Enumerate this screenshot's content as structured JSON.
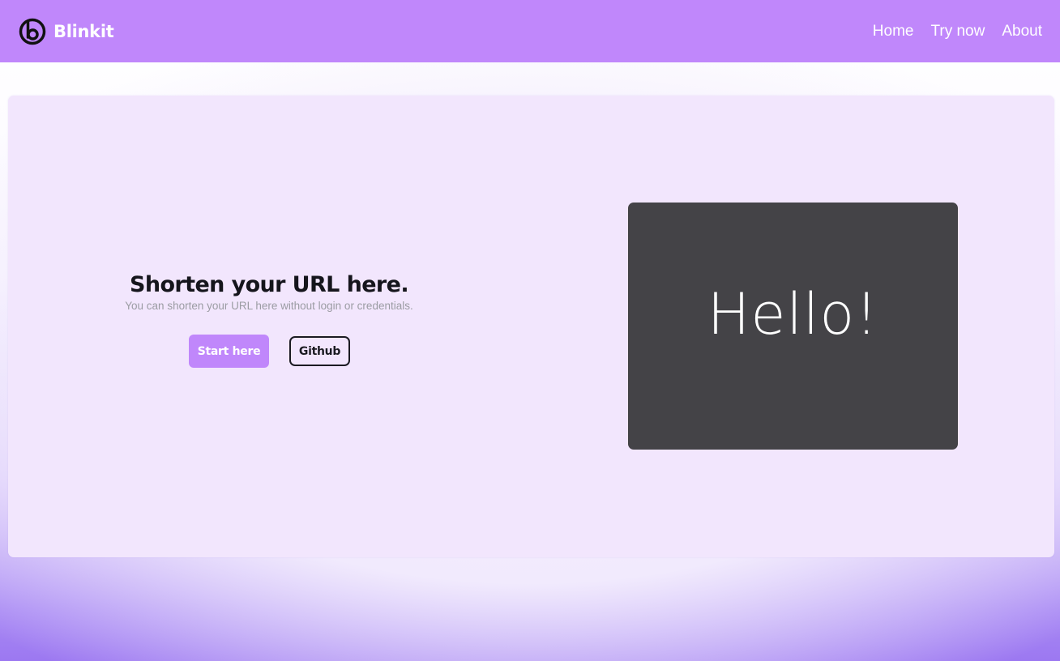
{
  "navbar": {
    "brand": {
      "name": "Blinkit",
      "icon": "blinkit-logo-icon"
    },
    "links": [
      {
        "label": "Home"
      },
      {
        "label": "Try now"
      },
      {
        "label": "About"
      }
    ]
  },
  "hero": {
    "title": "Shorten your URL here.",
    "subtitle": "You can shorten your URL here without login or credentials.",
    "primary_button": "Start here",
    "secondary_button": "Github",
    "preview_text": "Hello!"
  },
  "colors": {
    "accent": "#c087fb",
    "card_background": "#f2e6fd",
    "preview_background": "#444347",
    "text_dark": "#15151c",
    "text_muted": "#9b9ca3"
  }
}
